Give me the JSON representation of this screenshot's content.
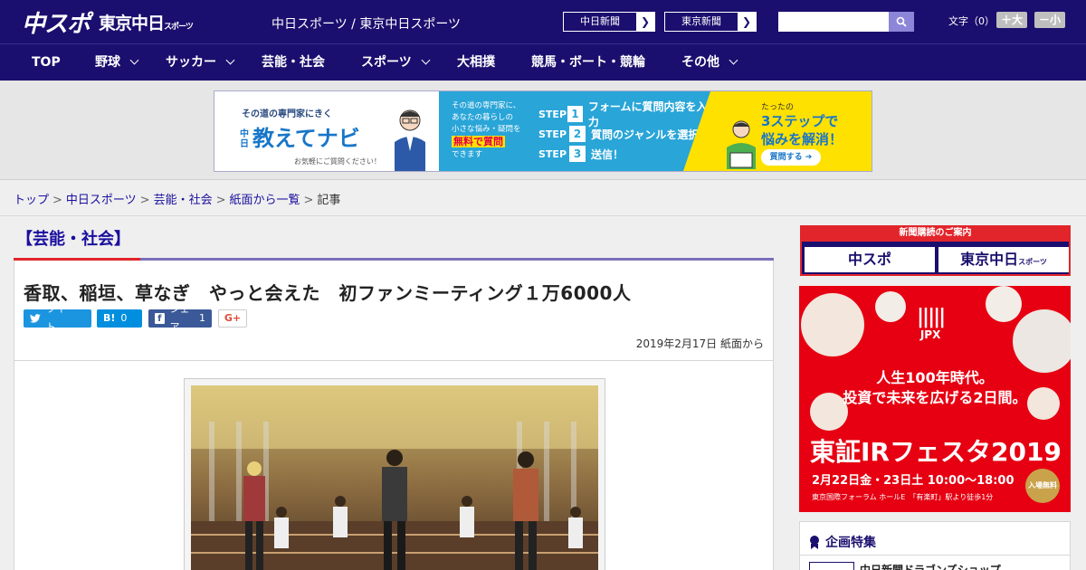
{
  "header": {
    "logo_main": "中スポ",
    "logo_tokyo": "東京中日",
    "logo_tokyo_small": "スポーツ",
    "site_title": "中日スポーツ / 東京中日スポーツ",
    "paper_buttons": [
      "中日新聞",
      "東京新聞"
    ],
    "search_placeholder": "",
    "font_size_label": "文字（0）",
    "font_larger": "＋大",
    "font_smaller": "－小",
    "brand_color": "#1a0f6e"
  },
  "nav": {
    "items": [
      {
        "label": "TOP",
        "has_menu": false
      },
      {
        "label": "野球",
        "has_menu": true
      },
      {
        "label": "サッカー",
        "has_menu": true
      },
      {
        "label": "芸能・社会",
        "has_menu": false
      },
      {
        "label": "スポーツ",
        "has_menu": true
      },
      {
        "label": "大相撲",
        "has_menu": false
      },
      {
        "label": "競馬・ボート・競輪",
        "has_menu": false
      },
      {
        "label": "その他",
        "has_menu": true
      }
    ]
  },
  "banner_ad": {
    "tagline": "その道の専門家にきく",
    "brand_prefix": "中日",
    "brand": "教えてナビ",
    "subtext": "お気軽にご質問ください！",
    "desc_lines": [
      "その道の専門家に、",
      "あなたの暮らしの",
      "小さな悩み・疑問を"
    ],
    "highlight": "無料で質問",
    "desc_tail": "できます",
    "steps": [
      {
        "label": "STEP",
        "num": "1",
        "text": "フォームに質問内容を入力"
      },
      {
        "label": "STEP",
        "num": "2",
        "text": "質問のジャンルを選択"
      },
      {
        "label": "STEP",
        "num": "3",
        "text": "送信！"
      }
    ],
    "right_small": "たったの",
    "right_big1": "3ステップで",
    "right_big2": "悩みを解消！",
    "cta": "質問する ➔"
  },
  "breadcrumb": [
    "トップ",
    "中日スポーツ",
    "芸能・社会",
    "紙面から一覧",
    "記事"
  ],
  "section_title": "【芸能・社会】",
  "article": {
    "headline": "香取、稲垣、草なぎ　やっと会えた　初ファンミーティング１万6000人",
    "share": {
      "tweet": "ツイート",
      "hatena": "0",
      "facebook": "シェア",
      "facebook_count": "1",
      "gplus": "G+"
    },
    "date": "2019年2月17日 紙面から"
  },
  "sidebar": {
    "subscribe_caption": "新聞購読のご案内",
    "subscribe_options": [
      "中スポ",
      "東京中日"
    ],
    "subscribe_small": "スポーツ",
    "ad": {
      "brand": "JPX",
      "line1": "人生100年時代。",
      "line2": "投資で未来を広げる2日間。",
      "festival": "東証IRフェスタ2019",
      "dates": "2月22日金・23日土 10:00～18:00",
      "venue": "東京国際フォーラム ホールE　「有楽町」駅より徒歩1分",
      "badge": "入場無料"
    },
    "feature_title": "企画特集",
    "feature_item": "中日新聞ドラゴンズショップ"
  }
}
